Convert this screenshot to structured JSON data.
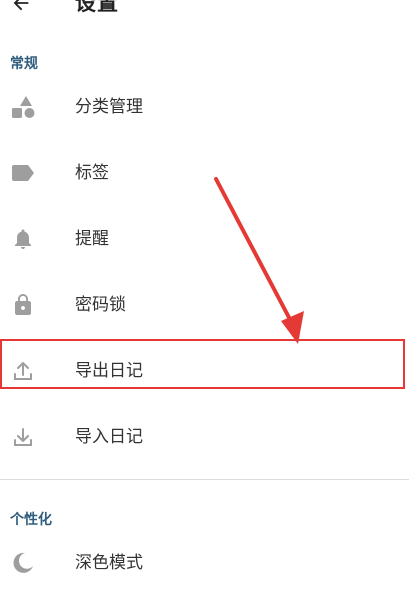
{
  "header": {
    "title": "设置",
    "back_icon": "arrow-back-icon"
  },
  "sections": [
    {
      "header": "常规",
      "items": [
        {
          "label": "分类管理",
          "icon": "shapes-icon"
        },
        {
          "label": "标签",
          "icon": "tag-icon"
        },
        {
          "label": "提醒",
          "icon": "bell-icon"
        },
        {
          "label": "密码锁",
          "icon": "lock-icon"
        },
        {
          "label": "导出日记",
          "icon": "upload-icon",
          "highlighted": true
        },
        {
          "label": "导入日记",
          "icon": "download-icon"
        }
      ]
    },
    {
      "header": "个性化",
      "items": [
        {
          "label": "深色模式",
          "icon": "moon-icon"
        }
      ]
    }
  ],
  "annotation": {
    "type": "red-arrow-and-box",
    "color": "#e53935",
    "target": "导出日记"
  },
  "colors": {
    "section_header": "#2f5d7d",
    "icon": "#9e9e9e",
    "annotation": "#e53935"
  }
}
